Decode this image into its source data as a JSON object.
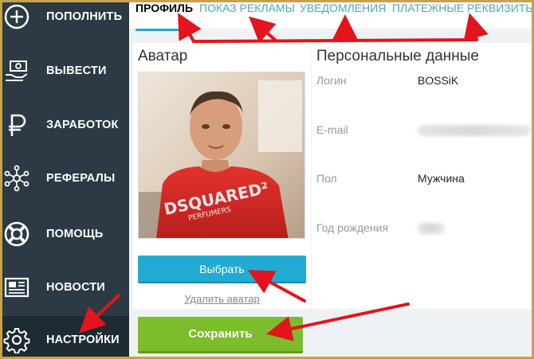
{
  "sidebar": {
    "items": [
      {
        "label": "ПОПОЛНИТЬ",
        "icon": "plus-circle-icon"
      },
      {
        "label": "ВЫВЕСТИ",
        "icon": "hand-money-icon"
      },
      {
        "label": "ЗАРАБОТОК",
        "icon": "ruble-icon"
      },
      {
        "label": "РЕФЕРАЛЫ",
        "icon": "network-icon"
      },
      {
        "label": "ПОМОЩЬ",
        "icon": "lifebuoy-icon"
      },
      {
        "label": "НОВОСТИ",
        "icon": "newspaper-icon"
      },
      {
        "label": "НАСТРОЙКИ",
        "icon": "gear-icon",
        "active": true
      }
    ]
  },
  "tabs": [
    {
      "label": "ПРОФИЛЬ",
      "active": true
    },
    {
      "label": "ПОКАЗ РЕКЛАМЫ"
    },
    {
      "label": "УВЕДОМЛЕНИЯ"
    },
    {
      "label": "ПЛАТЕЖНЫЕ РЕКВИЗИТЫ"
    }
  ],
  "avatar": {
    "title": "Аватар",
    "choose_label": "Выбрать",
    "delete_label": "Удалить аватар",
    "shirt_text_main": "DSQUARED²",
    "shirt_text_sub": "PERFUMERS"
  },
  "personal": {
    "title": "Персональные данные",
    "fields": [
      {
        "label": "Логин",
        "value": "BOSSiK"
      },
      {
        "label": "E-mail",
        "value": ""
      },
      {
        "label": "Пол",
        "value": "Мужчина"
      },
      {
        "label": "Год рождения",
        "value": ""
      }
    ]
  },
  "save_label": "Сохранить",
  "colors": {
    "sidebar_bg": "#2b3a44",
    "accent_blue": "#22aad2",
    "save_green": "#7cbd2b",
    "annotation_red": "#e3141b",
    "frame": "#c8a24a"
  }
}
